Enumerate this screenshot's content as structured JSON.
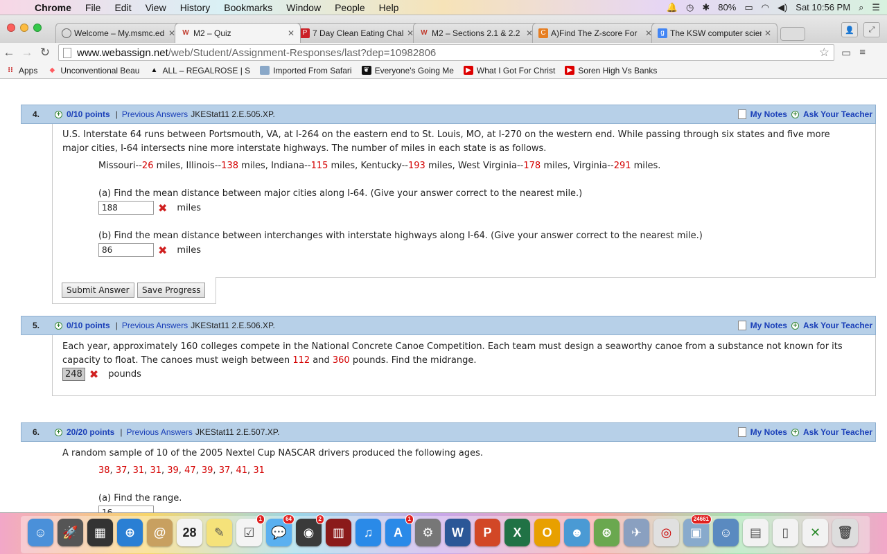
{
  "menubar": {
    "app_name": "Chrome",
    "items": [
      "File",
      "Edit",
      "View",
      "History",
      "Bookmarks",
      "Window",
      "People",
      "Help"
    ],
    "battery": "80%",
    "clock": "Sat 10:56 PM"
  },
  "tabs": [
    {
      "title": "Welcome – My.msmc.ed",
      "icon": "globe-icon",
      "color": "#666666"
    },
    {
      "title": "M2 – Quiz",
      "icon": "webassign-icon",
      "color": "#c0392b"
    },
    {
      "title": "7 Day Clean Eating Chal",
      "icon": "pinterest-icon",
      "color": "#cb2027"
    },
    {
      "title": "M2 – Sections 2.1 & 2.2",
      "icon": "webassign-icon",
      "color": "#c0392b"
    },
    {
      "title": "A)Find The Z-score For",
      "icon": "chegg-icon",
      "color": "#e67e22"
    },
    {
      "title": "The KSW computer scien",
      "icon": "google-icon",
      "color": "#4285f4"
    }
  ],
  "toolbar": {
    "url_host": "www.webassign.net",
    "url_path": "/web/Student/Assignment-Responses/last?dep=10982806"
  },
  "bookmarks": [
    {
      "label": "Apps",
      "icon": "apps-icon"
    },
    {
      "label": "Unconventional Beau",
      "icon": "airbnb-icon"
    },
    {
      "label": "ALL – REGALROSE | S",
      "icon": "regalrose-icon"
    },
    {
      "label": "Imported From Safari",
      "icon": "folder-icon"
    },
    {
      "label": "Everyone's Going Me",
      "icon": "playboy-icon"
    },
    {
      "label": "What I Got For Christ",
      "icon": "youtube-icon"
    },
    {
      "label": "Soren High Vs Banks",
      "icon": "youtube-icon"
    }
  ],
  "questions": {
    "q4": {
      "number": "4.",
      "points": "0/10 points",
      "prev_answers": "Previous Answers",
      "id": "JKEStat11 2.E.505.XP.",
      "intro": "U.S. Interstate 64 runs between Portsmouth, VA, at I-264 on the eastern end to St. Louis, MO, at I-270 on the western end. While passing through six states and five more major cities, I-64 intersects nine more interstate highways. The number of miles in each state is as follows.",
      "states": [
        {
          "name": "Missouri",
          "miles": "26"
        },
        {
          "name": "Illinois",
          "miles": "138"
        },
        {
          "name": "Indiana",
          "miles": "115"
        },
        {
          "name": "Kentucky",
          "miles": "193"
        },
        {
          "name": "West Virginia",
          "miles": "178"
        },
        {
          "name": "Virginia",
          "miles": "291"
        }
      ],
      "part_a": "(a) Find the mean distance between major cities along I-64. (Give your answer correct to the nearest mile.)",
      "answer_a": "188",
      "part_b": "(b) Find the mean distance between interchanges with interstate highways along I-64. (Give your answer correct to the nearest mile.)",
      "answer_b": "86",
      "unit": "miles",
      "submit": "Submit Answer",
      "save": "Save Progress"
    },
    "q5": {
      "number": "5.",
      "points": "0/10 points",
      "prev_answers": "Previous Answers",
      "id": "JKEStat11 2.E.506.XP.",
      "text_1": "Each year, approximately 160 colleges compete in the National Concrete Canoe Competition. Each team must design a seaworthy canoe from a substance not known for its capacity to float. The canoes must weigh between ",
      "low": "112",
      "text_2": " and ",
      "high": "360",
      "text_3": " pounds. Find the midrange.",
      "answer": "248",
      "unit": "pounds"
    },
    "q6": {
      "number": "6.",
      "points": "20/20 points",
      "prev_answers": "Previous Answers",
      "id": "JKEStat11 2.E.507.XP.",
      "intro": "A random sample of 10 of the 2005 Nextel Cup NASCAR drivers produced the following ages.",
      "ages": [
        "38",
        "37",
        "31",
        "31",
        "39",
        "47",
        "39",
        "37",
        "41",
        "31"
      ],
      "part_a": "(a) Find the range.",
      "answer_a": "16"
    },
    "my_notes": "My Notes",
    "ask_teacher": "Ask Your Teacher"
  },
  "dock": {
    "badges": {
      "contacts": "28",
      "reminders": "1",
      "messages": "64",
      "facetime": "2",
      "appstore": "1",
      "iphoto": "24661"
    }
  }
}
